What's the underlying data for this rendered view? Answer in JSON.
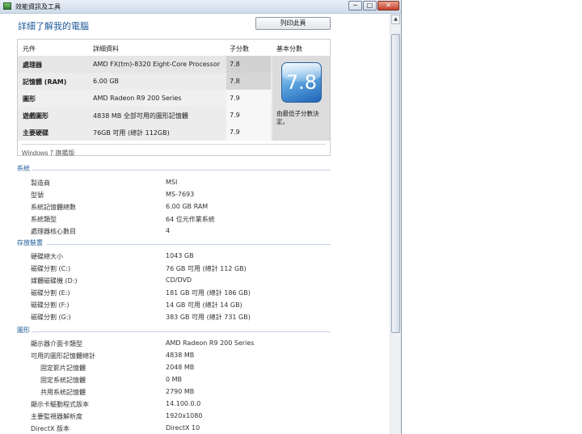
{
  "window": {
    "title": "效能資訊及工具",
    "min_glyph": "─",
    "max_glyph": "□",
    "close_glyph": "✕",
    "icon": "performance-tools-icon"
  },
  "page": {
    "title": "詳細了解我的電腦",
    "print_label": "列印此頁"
  },
  "score_table": {
    "headers": {
      "component": "元件",
      "detail": "詳細資料",
      "subscore": "子分數",
      "base": "基本分數"
    },
    "rows": [
      {
        "name": "處理器",
        "detail": "AMD FX(tm)-8320 Eight-Core Processor",
        "score": "7.8"
      },
      {
        "name": "記憶體 (RAM)",
        "detail": "6.00 GB",
        "score": "7.8"
      },
      {
        "name": "圖形",
        "detail": "AMD Radeon R9 200 Series",
        "score": "7.9"
      },
      {
        "name": "遊戲圖形",
        "detail": "4838 MB 全部可用的圖形記憶體",
        "score": "7.9"
      },
      {
        "name": "主要硬碟",
        "detail": "76GB 可用 (總計 112GB)",
        "score": "7.9"
      }
    ],
    "base_score": "7.8",
    "base_caption": "由最低子分數決定。",
    "edition": "Windows 7 旗艦版"
  },
  "system": {
    "header": "系統",
    "rows": [
      {
        "label": "製造商",
        "value": "MSI"
      },
      {
        "label": "型號",
        "value": "MS-7693"
      },
      {
        "label": "系統記憶體總數",
        "value": "6.00 GB RAM"
      },
      {
        "label": "系統類型",
        "value": "64 位元作業系統"
      },
      {
        "label": "處理器核心數目",
        "value": "4"
      }
    ]
  },
  "storage": {
    "header": "存放裝置",
    "rows": [
      {
        "label": "硬碟總大小",
        "value": "1043 GB"
      },
      {
        "label": "磁碟分割 (C:)",
        "value": "76 GB 可用 (總計 112 GB)"
      },
      {
        "label": "媒體磁碟機 (D:)",
        "value": "CD/DVD"
      },
      {
        "label": "磁碟分割 (E:)",
        "value": "181 GB 可用 (總計 186 GB)"
      },
      {
        "label": "磁碟分割 (F:)",
        "value": "14 GB 可用 (總計 14 GB)"
      },
      {
        "label": "磁碟分割 (G:)",
        "value": "383 GB 可用 (總計 731 GB)"
      }
    ]
  },
  "graphics": {
    "header": "圖形",
    "rows": [
      {
        "label": "顯示器介面卡類型",
        "value": "AMD Radeon R9 200 Series"
      },
      {
        "label": "可用的圖形記憶體總計",
        "value": "4838 MB"
      },
      {
        "label": "固定影片記憶體",
        "value": "2048 MB"
      },
      {
        "label": "固定系統記憶體",
        "value": "0 MB"
      },
      {
        "label": "共用系統記憶體",
        "value": "2790 MB"
      },
      {
        "label": "顯示卡驅動程式版本",
        "value": "14.100.0.0"
      },
      {
        "label": "主要監視器解析度",
        "value": "1920x1080"
      },
      {
        "label": "DirectX 版本",
        "value": "DirectX 10"
      }
    ]
  },
  "scrollbar": {
    "up_glyph": "▲"
  }
}
